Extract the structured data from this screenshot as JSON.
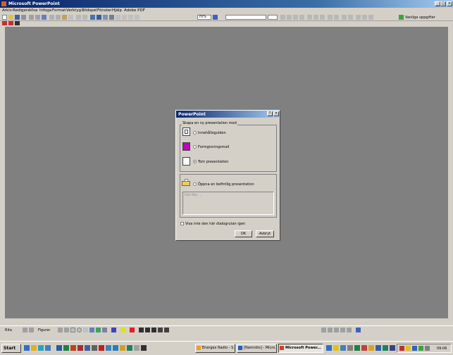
{
  "window": {
    "title": "Microsoft PowerPoint",
    "controls": [
      "_",
      "□",
      "×"
    ]
  },
  "menubar": {
    "items": [
      "Arkiv",
      "Redigera",
      "Visa",
      "Infoga",
      "Format",
      "Verktyg",
      "Bildspel",
      "Fönster",
      "Hjälp",
      "Adobe PDF"
    ]
  },
  "toolbar": {
    "zoom": "70%",
    "font_placeholder": "",
    "tasks_label": "Vanliga uppgifter"
  },
  "drawing_bar": {
    "draw_label": "Rita",
    "autoshapes_label": "Figurer"
  },
  "taskbar": {
    "start_label": "Start",
    "buttons": [
      {
        "label": "Energex Radio - S...",
        "active": false
      },
      {
        "label": "[Namnlös] - Micro...",
        "active": false
      },
      {
        "label": "Microsoft Power...",
        "active": true
      }
    ],
    "clock": "09:06"
  },
  "dialog": {
    "title": "PowerPoint",
    "help_button": "?",
    "close_button": "×",
    "group_label": "Skapa en ny presentation med",
    "options": [
      {
        "label": "Innehållsguiden",
        "checked": false,
        "icon": "content-wizard-icon"
      },
      {
        "label": "Formgivningsmall",
        "checked": false,
        "icon": "design-template-icon"
      },
      {
        "label": "Tom presentation",
        "checked": true,
        "icon": "blank-presentation-icon"
      },
      {
        "label": "Öppna en befintlig presentation",
        "checked": false,
        "icon": "open-folder-icon"
      }
    ],
    "file_list_item": "Fler filer ...",
    "dont_show_label": "Visa inte den här dialogrutan igen",
    "ok_label": "OK",
    "cancel_label": "Avbryt"
  }
}
